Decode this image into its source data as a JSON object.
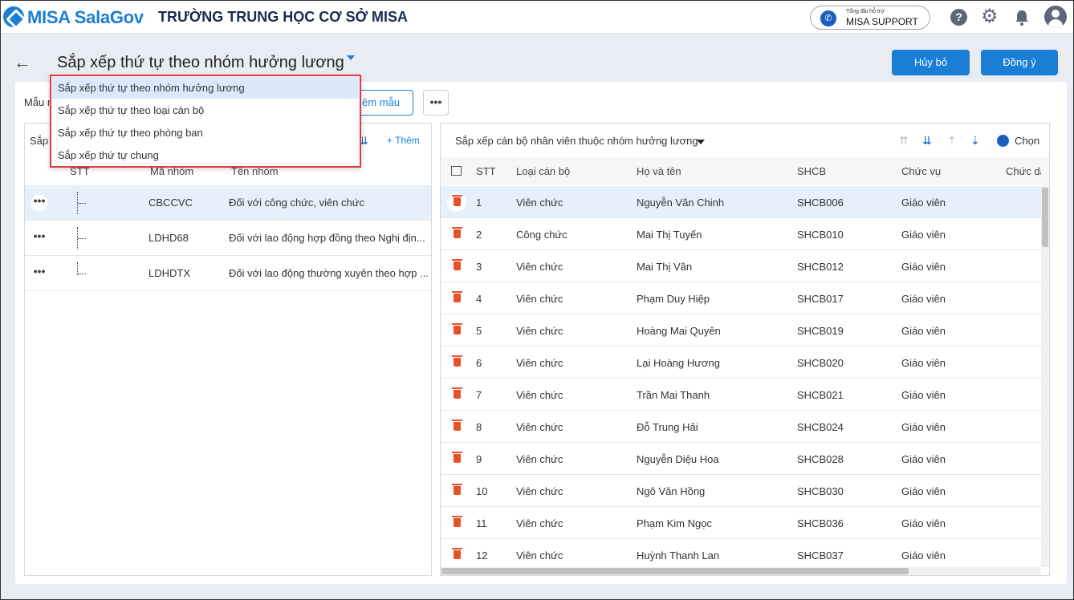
{
  "app": {
    "logo": "MISA SalaGov",
    "school": "TRƯỜNG TRUNG HỌC CƠ SỞ MISA",
    "support_small": "Tổng đài hỗ trợ",
    "support_big": "MISA SUPPORT",
    "icons": [
      "help-icon",
      "gear-icon",
      "bell-icon",
      "user-avatar-icon"
    ]
  },
  "page": {
    "title": "Sắp xếp thứ tự theo nhóm hưởng lương",
    "cancel_label": "Hủy bỏ",
    "ok_label": "Đồng ý",
    "mau_label": "Mẫu n",
    "mau_button": "êm mẫu",
    "more_label": "•••"
  },
  "dropdown": {
    "items": [
      {
        "label": "Sắp xếp thứ tự theo nhóm hưởng lương",
        "active": true
      },
      {
        "label": "Sắp xếp thứ tự theo loại cán bộ"
      },
      {
        "label": "Sắp xếp thứ tự theo phòng ban"
      },
      {
        "label": "Sắp xếp thứ tự chung"
      }
    ]
  },
  "left_grid": {
    "header_label": "Sắp",
    "add_label": "+ Thêm",
    "columns": [
      "STT",
      "Mã nhóm",
      "Tên nhóm"
    ],
    "rows": [
      {
        "code": "CBCCVC",
        "name": "Đối với công chức, viên chức",
        "selected": true
      },
      {
        "code": "LDHD68",
        "name": "Đối với lao động hợp đồng theo Nghị địn..."
      },
      {
        "code": "LDHDTX",
        "name": "Đối với lao động thường xuyên theo hợp ..."
      }
    ]
  },
  "right_grid": {
    "title": "Sắp xếp cán bộ nhân viên thuộc nhóm hưởng lương",
    "choose_label": "Chọn",
    "columns": [
      "STT",
      "Loại cán bộ",
      "Họ và tên",
      "SHCB",
      "Chức vụ",
      "Chức dan"
    ],
    "rows": [
      {
        "stt": "1",
        "type": "Viên chức",
        "name": "Nguyễn Văn Chinh",
        "shcb": "SHCB006",
        "role": "Giáo viên"
      },
      {
        "stt": "2",
        "type": "Công chức",
        "name": "Mai Thị Tuyến",
        "shcb": "SHCB010",
        "role": "Giáo viên"
      },
      {
        "stt": "3",
        "type": "Viên chức",
        "name": "Mai Thị Vân",
        "shcb": "SHCB012",
        "role": "Giáo viên"
      },
      {
        "stt": "4",
        "type": "Viên chức",
        "name": "Phạm Duy Hiệp",
        "shcb": "SHCB017",
        "role": "Giáo viên"
      },
      {
        "stt": "5",
        "type": "Viên chức",
        "name": "Hoàng Mai Quyên",
        "shcb": "SHCB019",
        "role": "Giáo viên"
      },
      {
        "stt": "6",
        "type": "Viên chức",
        "name": "Lại Hoàng Hương",
        "shcb": "SHCB020",
        "role": "Giáo viên"
      },
      {
        "stt": "7",
        "type": "Viên chức",
        "name": "Trần Mai Thanh",
        "shcb": "SHCB021",
        "role": "Giáo viên"
      },
      {
        "stt": "8",
        "type": "Viên chức",
        "name": "Đỗ Trung Hải",
        "shcb": "SHCB024",
        "role": "Giáo viên"
      },
      {
        "stt": "9",
        "type": "Viên chức",
        "name": "Nguyễn Diệu Hoa",
        "shcb": "SHCB028",
        "role": "Giáo viên"
      },
      {
        "stt": "10",
        "type": "Viên chức",
        "name": "Ngô Văn Hồng",
        "shcb": "SHCB030",
        "role": "Giáo viên"
      },
      {
        "stt": "11",
        "type": "Viên chức",
        "name": "Phạm Kim Ngọc",
        "shcb": "SHCB036",
        "role": "Giáo viên"
      },
      {
        "stt": "12",
        "type": "Viên chức",
        "name": "Huỳnh Thanh Lan",
        "shcb": "SHCB037",
        "role": "Giáo viên"
      }
    ]
  },
  "colors": {
    "primary": "#1a7fd4",
    "selected_row": "#e5f0fb",
    "danger": "#e8502a",
    "highlight_border": "#e0393e"
  }
}
